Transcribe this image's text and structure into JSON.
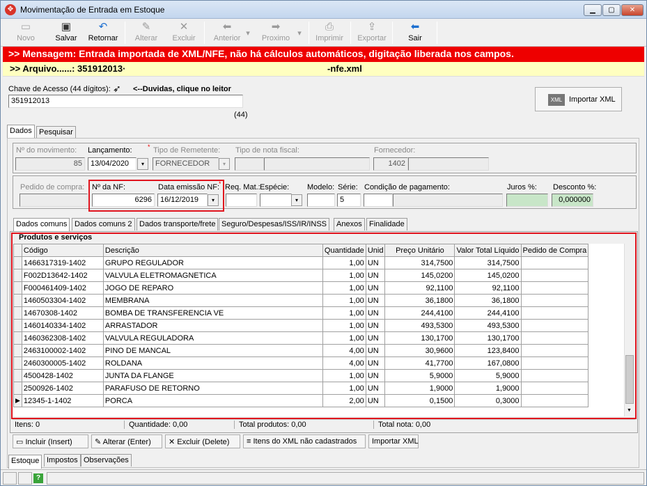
{
  "window": {
    "title": "Movimentação de Entrada em Estoque",
    "min": "▁",
    "max": "▢",
    "close": "✕"
  },
  "toolbar": {
    "novo": "Novo",
    "salvar": "Salvar",
    "retornar": "Retornar",
    "alterar": "Alterar",
    "excluir": "Excluir",
    "anterior": "Anterior",
    "proximo": "Proximo",
    "imprimir": "Imprimir",
    "exportar": "Exportar",
    "sair": "Sair"
  },
  "message": ">> Mensagem: Entrada importada de XML/NFE, não há cálculos automáticos, digitação liberada nos campos.",
  "arquivo": {
    "prefix": ">> Arquivo......: 351912013·",
    "suffix": "-nfe.xml"
  },
  "chave": {
    "label": "Chave de Acesso (44 dígitos):",
    "help": "<--Duvidas, clique no leitor",
    "value": "351912013",
    "count": "(44)"
  },
  "importar_xml": "Importar XML",
  "xml_badge": "XML",
  "tabs_top": [
    "Dados",
    "Pesquisar"
  ],
  "row1": {
    "num_mov_label": "Nº do movimento:",
    "num_mov": "85",
    "lanc_label": "Lançamento:",
    "lanc": "13/04/2020",
    "remetente_label": "Tipo de Remetente:",
    "remetente": "FORNECEDOR",
    "tipo_nota_label": "Tipo de nota fiscal:",
    "fornecedor_label": "Fornecedor:",
    "fornecedor": "1402"
  },
  "row2": {
    "pedido_label": "Pedido de compra:",
    "nf_label": "Nº da NF:",
    "nf": "6296",
    "data_emissao_label": "Data emissão NF:",
    "data_emissao": "16/12/2019",
    "req_label": "Req. Mat.:",
    "especie_label": "Espécie:",
    "modelo_label": "Modelo:",
    "serie_label": "Série:",
    "serie": "5",
    "condicao_label": "Condição de pagamento:",
    "juros_label": "Juros %:",
    "desconto_label": "Desconto %:",
    "desconto": "0,000000"
  },
  "subtabs": [
    "Dados comuns",
    "Dados comuns 2",
    "Dados transporte/frete",
    "Seguro/Despesas/ISS/IR/INSS",
    "Anexos",
    "Finalidade"
  ],
  "produtos_title": "Produtos e serviços",
  "columns": [
    "Código",
    "Descrição",
    "Quantidade",
    "Unid",
    "Preço Unitário",
    "Valor Total Líquido",
    "Pedido de Compra"
  ],
  "rows": [
    [
      "1466317319-1402",
      "GRUPO REGULADOR",
      "1,00",
      "UN",
      "314,7500",
      "314,7500",
      ""
    ],
    [
      "F002D13642-1402",
      "VALVULA ELETROMAGNETICA",
      "1,00",
      "UN",
      "145,0200",
      "145,0200",
      ""
    ],
    [
      "F000461409-1402",
      "JOGO DE REPARO",
      "1,00",
      "UN",
      "92,1100",
      "92,1100",
      ""
    ],
    [
      "1460503304-1402",
      "MEMBRANA",
      "1,00",
      "UN",
      "36,1800",
      "36,1800",
      ""
    ],
    [
      "14670308-1402",
      "BOMBA DE TRANSFERENCIA VE",
      "1,00",
      "UN",
      "244,4100",
      "244,4100",
      ""
    ],
    [
      "1460140334-1402",
      "ARRASTADOR",
      "1,00",
      "UN",
      "493,5300",
      "493,5300",
      ""
    ],
    [
      "1460362308-1402",
      "VALVULA REGULADORA",
      "1,00",
      "UN",
      "130,1700",
      "130,1700",
      ""
    ],
    [
      "2463100002-1402",
      "PINO DE MANCAL",
      "4,00",
      "UN",
      "30,9600",
      "123,8400",
      ""
    ],
    [
      "2460300005-1402",
      "ROLDANA",
      "4,00",
      "UN",
      "41,7700",
      "167,0800",
      ""
    ],
    [
      "4500428-1402",
      "JUNTA DA FLANGE",
      "1,00",
      "UN",
      "5,9000",
      "5,9000",
      ""
    ],
    [
      "2500926-1402",
      "PARAFUSO DE RETORNO",
      "1,00",
      "UN",
      "1,9000",
      "1,9000",
      ""
    ],
    [
      "12345-1-1402",
      "PORCA",
      "2,00",
      "UN",
      "0,1500",
      "0,3000",
      ""
    ]
  ],
  "totals": {
    "itens": "Itens: 0",
    "quantidade": "Quantidade: 0,00",
    "total_produtos": "Total produtos: 0,00",
    "total_nota": "Total nota: 0,00"
  },
  "bottom_buttons": {
    "incluir": "Incluir (Insert)",
    "alterar": "Alterar (Enter)",
    "excluir": "Excluir (Delete)",
    "itens_xml": "Itens do XML não cadastrados",
    "importar": "Importar XML"
  },
  "tabs_bottom": [
    "Estoque",
    "Impostos",
    "Observações"
  ]
}
